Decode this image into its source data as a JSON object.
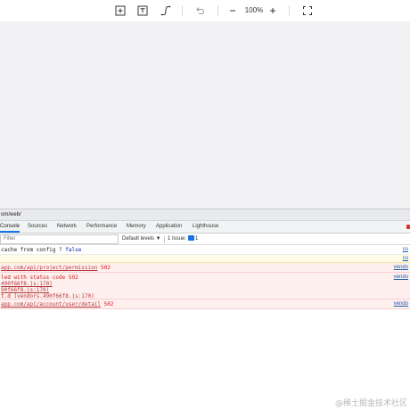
{
  "toolbar": {
    "zoom": "100%",
    "icons": [
      "add-frame-icon",
      "text-tool-icon",
      "connector-icon",
      "undo-icon",
      "zoom-out-icon",
      "zoom-in-icon",
      "fullscreen-icon"
    ]
  },
  "devtools": {
    "url": "om/web/",
    "tabs": [
      "Console",
      "Sources",
      "Network",
      "Performance",
      "Memory",
      "Application",
      "Lighthouse"
    ],
    "active_tab": "Console",
    "filter_placeholder": "Filter",
    "levels_label": "Default levels ▼",
    "issue_label": "1 Issue:",
    "issue_count": "1"
  },
  "console": {
    "row1": {
      "text": "cache from config ?  ",
      "value": "false",
      "source": "co"
    },
    "row2": {
      "source": "co"
    },
    "err1": {
      "url": "app.com/api/project/permission",
      "code": "502",
      "source": "vendo"
    },
    "err2": {
      "line1": "led with status code 502",
      "line2": "490f66f8.js:170)",
      "line3": "90f66f8.js:170)",
      "line4_prefix": "t.d (",
      "line4_link": "vendors.490f66f8.js:170",
      "line4_suffix": ")",
      "source": "vendo"
    },
    "err3": {
      "url": "app.com/api/account/user/detail",
      "code": "502",
      "source": "vendo"
    }
  },
  "watermark": "@稀土掘金技术社区",
  "colors": {
    "accent": "#1a73e8",
    "error": "#d01c1c",
    "canvas": "#f2f2f4"
  }
}
